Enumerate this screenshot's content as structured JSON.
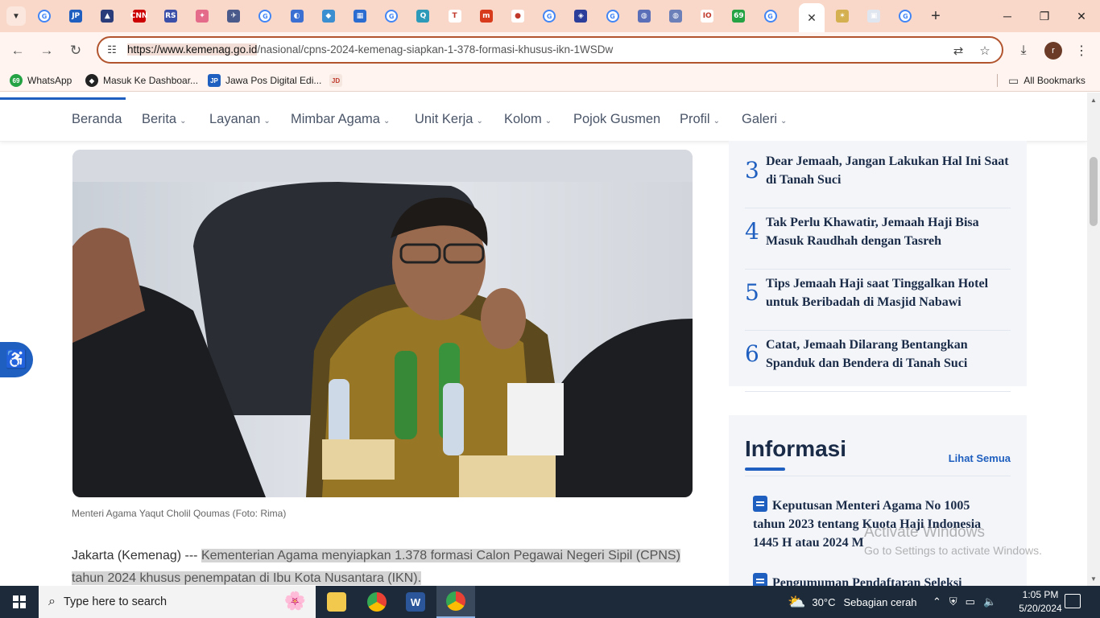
{
  "browser": {
    "tabs": [
      {
        "icon": "google-icon",
        "label": "G",
        "bg": "#ffffff"
      },
      {
        "icon": "jawapos-icon",
        "label": "JP",
        "bg": "#1f5fbf"
      },
      {
        "icon": "arrow-app-icon",
        "label": "▲",
        "bg": "#2a3d7a"
      },
      {
        "icon": "cnn-icon",
        "label": "CNN",
        "bg": "#cc0000"
      },
      {
        "icon": "rs-icon",
        "label": "RS",
        "bg": "#3b4fa8"
      },
      {
        "icon": "figure-icon",
        "label": "✦",
        "bg": "#e46b8a"
      },
      {
        "icon": "plane-icon",
        "label": "✈",
        "bg": "#4a5a8a"
      },
      {
        "icon": "google-icon",
        "label": "G",
        "bg": "#ffffff"
      },
      {
        "icon": "gemini-icon",
        "label": "◐",
        "bg": "#3b6fd1"
      },
      {
        "icon": "diamond-icon",
        "label": "◆",
        "bg": "#3b8fd1"
      },
      {
        "icon": "chart-app-icon",
        "label": "▦",
        "bg": "#2b6cd1"
      },
      {
        "icon": "google-icon",
        "label": "G",
        "bg": "#ffffff"
      },
      {
        "icon": "q-app-icon",
        "label": "Q",
        "bg": "#2c9ab8"
      },
      {
        "icon": "t-app-icon",
        "label": "T",
        "bg": "#ffffff"
      },
      {
        "icon": "m-app-icon",
        "label": "m",
        "bg": "#d83b1b"
      },
      {
        "icon": "orange-app-icon",
        "label": "●",
        "bg": "#ffffff"
      },
      {
        "icon": "google-icon",
        "label": "G",
        "bg": "#ffffff"
      },
      {
        "icon": "crest-icon",
        "label": "◈",
        "bg": "#2b3f9a"
      },
      {
        "icon": "google-icon",
        "label": "G",
        "bg": "#ffffff"
      },
      {
        "icon": "web-app-icon",
        "label": "◍",
        "bg": "#5b6fb8"
      },
      {
        "icon": "web-app-icon",
        "label": "◍",
        "bg": "#6b7fb8"
      },
      {
        "icon": "io-app-icon",
        "label": "IO",
        "bg": "#ffffff"
      },
      {
        "icon": "whatsapp-icon",
        "label": "69",
        "bg": "#25a244"
      },
      {
        "icon": "google-icon",
        "label": "G",
        "bg": "#ffffff"
      }
    ],
    "after_active_tabs": [
      {
        "icon": "kemenag-icon",
        "label": "✶",
        "bg": "#d4b050"
      },
      {
        "icon": "image-app-icon",
        "label": "▣",
        "bg": "#e0e6f0"
      },
      {
        "icon": "google-icon",
        "label": "G",
        "bg": "#ffffff"
      }
    ],
    "active_tab_close": "✕",
    "new_tab": "+",
    "url_host": "https://www.kemenag.go.id",
    "url_path": "/nasional/cpns-2024-kemenag-siapkan-1-378-formasi-khusus-ikn-1WSDw",
    "profile_initial": "r",
    "bookmarks": [
      {
        "label": "WhatsApp",
        "icon": "whatsapp-icon",
        "badge": "69"
      },
      {
        "label": "Masuk Ke Dashboar...",
        "icon": "dashboard-icon",
        "badge": "◆"
      },
      {
        "label": "Jawa Pos Digital Edi...",
        "icon": "jawapos-icon",
        "badge": "JP"
      },
      {
        "label": "",
        "icon": "jdih-icon",
        "badge": "JD"
      }
    ],
    "all_bookmarks": "All Bookmarks"
  },
  "site": {
    "nav": [
      {
        "label": "Beranda",
        "has_menu": false
      },
      {
        "label": "Berita",
        "has_menu": true
      },
      {
        "label": "Layanan",
        "has_menu": true
      },
      {
        "label": "Mimbar Agama",
        "has_menu": true
      },
      {
        "label": "Unit Kerja",
        "has_menu": true
      },
      {
        "label": "Kolom",
        "has_menu": true
      },
      {
        "label": "Pojok Gusmen",
        "has_menu": false
      },
      {
        "label": "Profil",
        "has_menu": true
      },
      {
        "label": "Galeri",
        "has_menu": true
      }
    ],
    "chevron": "⌄"
  },
  "article": {
    "caption": "Menteri Agama Yaqut Cholil Qoumas (Foto: Rima)",
    "lead_prefix": "Jakarta (Kemenag) --- ",
    "lead_highlight_1": "Kementerian Agama menyiapkan 1.378 formasi Calon Pegawai Negeri Sipil (CPNS)",
    "lead_highlight_2": "tahun 2024 khusus penempatan di Ibu Kota Nusantara (IKN)."
  },
  "popular": [
    {
      "num": "3",
      "title": "Dear Jemaah, Jangan Lakukan Hal Ini Saat di Tanah Suci"
    },
    {
      "num": "4",
      "title": "Tak Perlu Khawatir, Jemaah Haji Bisa Masuk Raudhah dengan Tasreh"
    },
    {
      "num": "5",
      "title": "Tips Jemaah Haji saat Tinggalkan Hotel untuk Beribadah di Masjid Nabawi"
    },
    {
      "num": "6",
      "title": "Catat, Jemaah Dilarang Bentangkan Spanduk dan Bendera di Tanah Suci"
    }
  ],
  "info": {
    "title": "Informasi",
    "more": "Lihat Semua",
    "items": [
      "Keputusan Menteri Agama No 1005 tahun 2023 tentang Kuota Haji Indonesia 1445 H atau 2024 M",
      "Pengumuman Pendaftaran Seleksi"
    ]
  },
  "watermark": {
    "line1": "Activate Windows",
    "line2": "Go to Settings to activate Windows."
  },
  "taskbar": {
    "search_placeholder": "Type here to search",
    "weather_temp": "30°C",
    "weather_text": "Sebagian cerah",
    "time": "1:05 PM",
    "date": "5/20/2024",
    "apps": [
      {
        "name": "file-explorer-icon",
        "color": "#f2c94c"
      },
      {
        "name": "chrome-icon",
        "color": "#e94235"
      },
      {
        "name": "word-icon",
        "color": "#2b579a"
      },
      {
        "name": "chrome-icon",
        "color": "#e94235"
      }
    ]
  }
}
